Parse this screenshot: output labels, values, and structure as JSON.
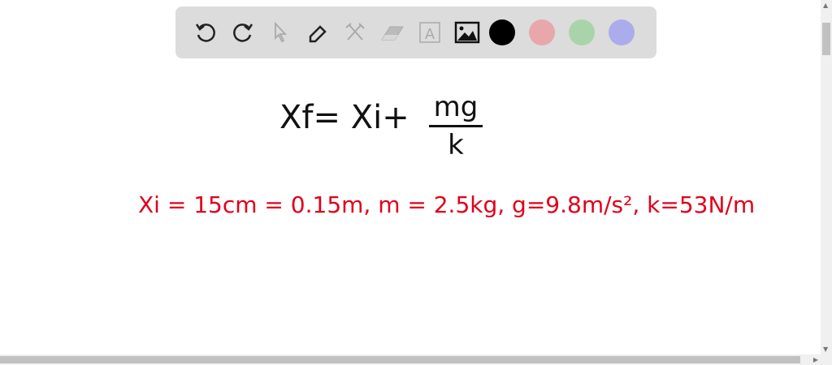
{
  "toolbar": {
    "tools": [
      {
        "name": "undo",
        "glyph": "↺",
        "enabled": true
      },
      {
        "name": "redo",
        "glyph": "↻",
        "enabled": true
      },
      {
        "name": "select",
        "glyph": "⇖",
        "enabled": false
      },
      {
        "name": "pen",
        "glyph": "✎",
        "enabled": true
      },
      {
        "name": "tools",
        "glyph": "⚒",
        "enabled": false
      },
      {
        "name": "eraser",
        "glyph": "▱",
        "enabled": false
      },
      {
        "name": "text",
        "glyph": "A",
        "enabled": false
      },
      {
        "name": "image",
        "glyph": "🖼",
        "enabled": true
      }
    ],
    "colors": [
      "#000000",
      "#e8a7ab",
      "#a9d4a9",
      "#acacec"
    ]
  },
  "canvas": {
    "equation_lhs": "Xf= Xi+",
    "equation_num": "mg",
    "equation_den": "k",
    "givens": "Xi = 15cm = 0.15m, m = 2.5kg, g=9.8m/s², k=53N/m"
  }
}
